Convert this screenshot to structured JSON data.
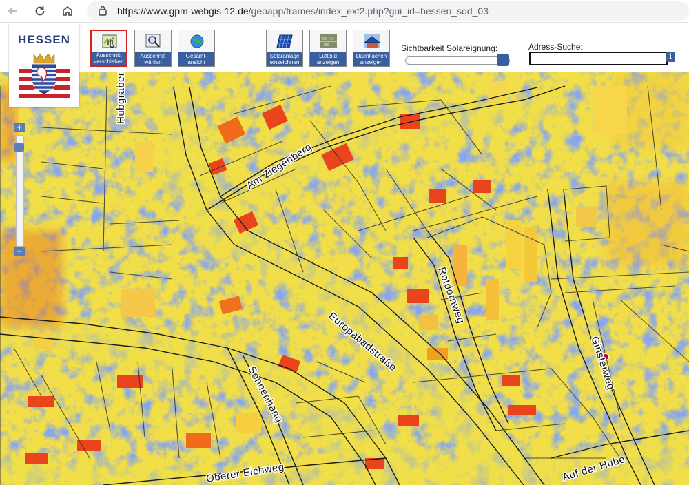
{
  "browser": {
    "url_host": "https://www.gpm-webgis-12.de",
    "url_path": "/geoapp/frames/index_ext2.php?gui_id=hessen_sod_03"
  },
  "logo": {
    "text": "HESSEN"
  },
  "toolbar": {
    "pan": {
      "line1": "Ausschnitt",
      "line2": "verschieben"
    },
    "zoom_select": {
      "line1": "Ausschnitt",
      "line2": "wählen"
    },
    "full_view": {
      "line1": "Gesamt-",
      "line2": "ansicht"
    },
    "draw_solar": {
      "line1": "Solaranlage",
      "line2": "einzeichnen"
    },
    "aerial": {
      "line1": "Luftbild",
      "line2": "anzeigen"
    },
    "roof_areas": {
      "line1": "Dachflächen",
      "line2": "anzeigen"
    }
  },
  "visibility": {
    "label": "Sichtbarkeit Solareignung:",
    "value_percent": 100
  },
  "address_search": {
    "label": "Adress-Suche:",
    "value": "",
    "info": "i"
  },
  "zoom": {
    "plus": "+",
    "minus": "−"
  },
  "streets": {
    "hubgraben": "Hubgraben",
    "am_ziegenberg": "Am Ziegenberg",
    "rotdornweg": "Rotdornweg",
    "europabadstrasse": "Europabadstraße",
    "sonnenhang": "Sonnenhang",
    "ginsterweg": "Ginsterweg",
    "oberer_eichweg": "Oberer Eichweg",
    "auf_der_hube": "Auf der Hube"
  },
  "colors": {
    "accent": "#3a5fa0",
    "active_border": "#d42020",
    "map_yellow": "#f4e04a",
    "map_blue": "#3d5fd8",
    "map_orange": "#f07a1e",
    "map_red": "#e0301a"
  }
}
